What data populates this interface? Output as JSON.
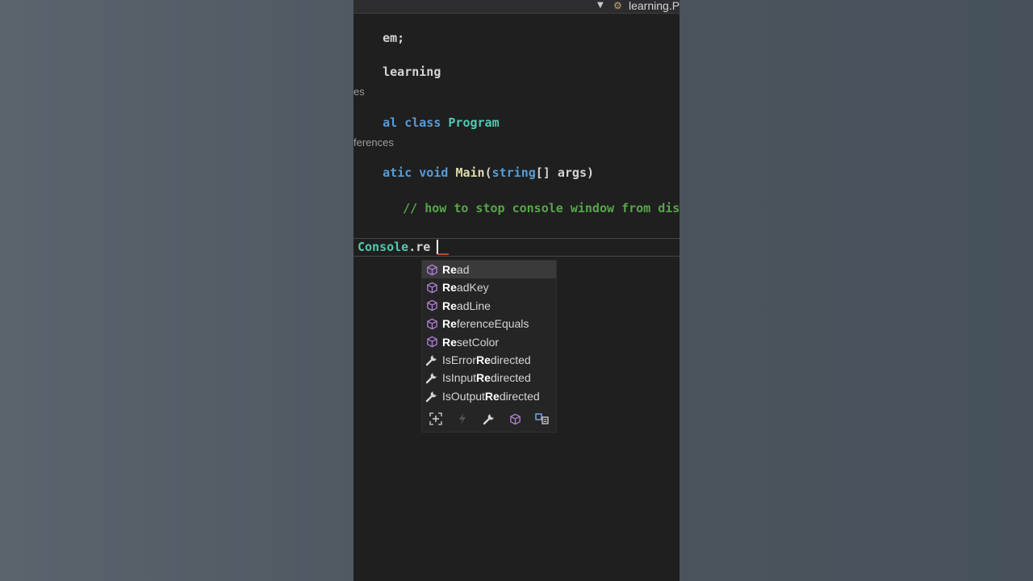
{
  "editor": {
    "tab_title": "learning.Pr",
    "lines": {
      "using_tail": "em;",
      "namespace_tail": "learning",
      "codelens_class": "es",
      "class_kw_tail": "al",
      "class_kw": "class",
      "class_name": "Program",
      "codelens_main": "ferences",
      "static_tail": "atic",
      "void_kw": "void",
      "main_name": "Main",
      "paren_open": "(",
      "string_kw": "string",
      "args_text": "[] args)",
      "comment": "// how to stop console window from disa"
    },
    "typed": {
      "class_part": "Console",
      "dot": ".",
      "partial": "re"
    }
  },
  "completion": {
    "items": [
      {
        "match": "Re",
        "rest": "ad",
        "prefix": "",
        "kind": "method-icon",
        "selected": true
      },
      {
        "match": "Re",
        "rest": "adKey",
        "prefix": "",
        "kind": "method-icon",
        "selected": false
      },
      {
        "match": "Re",
        "rest": "adLine",
        "prefix": "",
        "kind": "method-icon",
        "selected": false
      },
      {
        "match": "Re",
        "rest": "ferenceEquals",
        "prefix": "",
        "kind": "method-icon",
        "selected": false
      },
      {
        "match": "Re",
        "rest": "setColor",
        "prefix": "",
        "kind": "method-icon",
        "selected": false
      },
      {
        "prefix": "IsError",
        "match": "Re",
        "rest": "directed",
        "kind": "property-icon",
        "selected": false
      },
      {
        "prefix": "IsInput",
        "match": "Re",
        "rest": "directed",
        "kind": "property-icon",
        "selected": false
      },
      {
        "prefix": "IsOutput",
        "match": "Re",
        "rest": "directed",
        "kind": "property-icon",
        "selected": false
      }
    ],
    "filters": [
      "expand-filter-icon",
      "event-filter-icon",
      "property-filter-icon",
      "method-filter-icon",
      "extension-filter-icon"
    ]
  },
  "colors": {
    "method_icon": "#b180d7",
    "property_icon": "#d4d4d4",
    "keyword": "#569cd6",
    "type": "#4ec9b0",
    "comment": "#57a64a"
  }
}
